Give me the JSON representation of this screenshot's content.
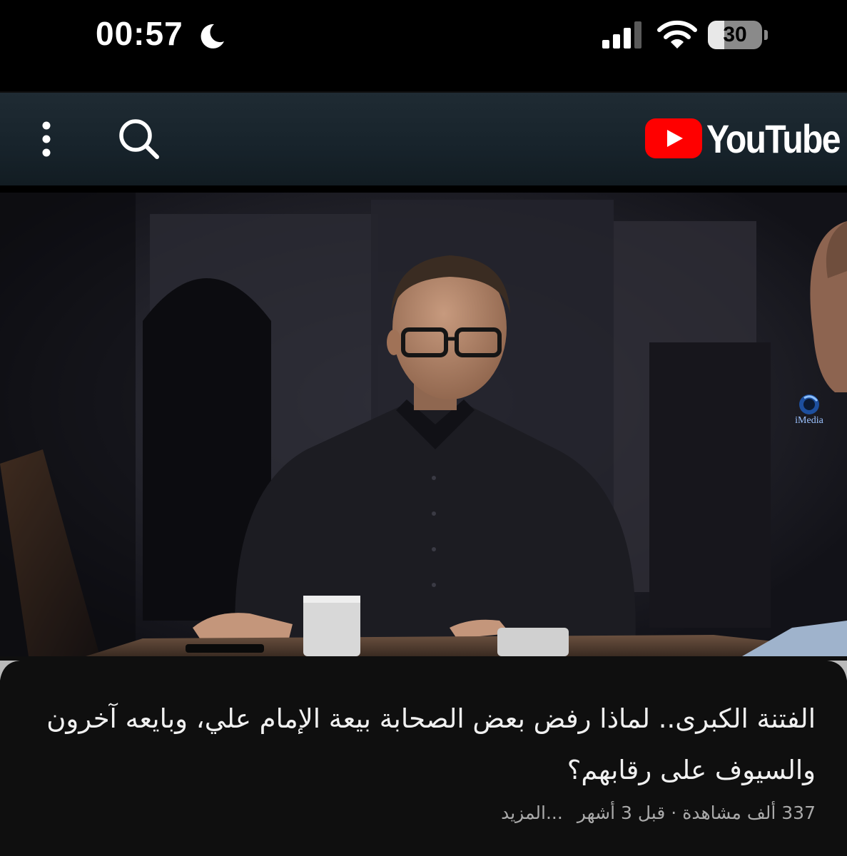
{
  "status_bar": {
    "time": "00:57",
    "battery_level": "30",
    "battery_percent": 30,
    "icons": [
      "moon-icon",
      "cellular-signal-icon",
      "wifi-icon",
      "battery-icon"
    ]
  },
  "header": {
    "logo_text": "YouTube",
    "icons": [
      "more-vertical-icon",
      "search-icon",
      "youtube-play-icon"
    ],
    "brand_color": "#ff0000"
  },
  "video": {
    "watermark": "iMedia",
    "title": "الفتنة الكبرى.. لماذا رفض بعض الصحابة بيعة الإمام علي، وبايعه آخرون والسيوف على رقابهم؟",
    "views": "337 ألف مشاهدة",
    "separator": "·",
    "age": "قبل 3 أشهر",
    "more_label": "...المزيد"
  }
}
